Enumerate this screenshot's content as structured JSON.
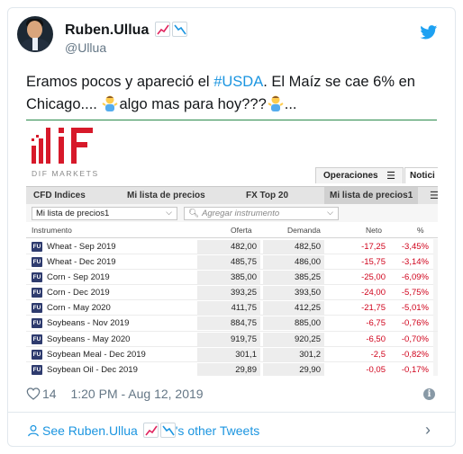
{
  "tweet": {
    "display_name": "Ruben.Ullua",
    "handle": "@Ullua",
    "text_part1": "Eramos pocos y apareció el ",
    "hashtag": "#USDA",
    "text_part2": ". El Maíz se cae 6% en Chicago.... ",
    "text_part3": "algo mas para hoy???",
    "text_part4": "...",
    "likes": "14",
    "timestamp": "1:20 PM - Aug 12, 2019",
    "footer_see": "See Ruben.Ullua",
    "footer_other": "'s other Tweets"
  },
  "platform": {
    "brand": "DIF MARKETS",
    "top_tabs": [
      "Operaciones",
      "Notici"
    ],
    "tabs": [
      "CFD Indices",
      "Mi lista de precios",
      "FX Top 20",
      "Mi lista de precios1"
    ],
    "active_tab_index": 3,
    "selected_list": "Mi lista de precios1",
    "search_placeholder": "Agregar instrumento",
    "columns": {
      "instrument": "Instrumento",
      "bid": "Oferta",
      "ask": "Demanda",
      "net": "Neto",
      "pct": "%"
    },
    "badge": "FU",
    "rows": [
      {
        "name": "Wheat - Sep 2019",
        "bid": "482,00",
        "ask": "482,50",
        "net": "-17,25",
        "pct": "-3,45%"
      },
      {
        "name": "Wheat - Dec 2019",
        "bid": "485,75",
        "ask": "486,00",
        "net": "-15,75",
        "pct": "-3,14%"
      },
      {
        "name": "Corn - Sep 2019",
        "bid": "385,00",
        "ask": "385,25",
        "net": "-25,00",
        "pct": "-6,09%"
      },
      {
        "name": "Corn - Dec 2019",
        "bid": "393,25",
        "ask": "393,50",
        "net": "-24,00",
        "pct": "-5,75%"
      },
      {
        "name": "Corn - May 2020",
        "bid": "411,75",
        "ask": "412,25",
        "net": "-21,75",
        "pct": "-5,01%"
      },
      {
        "name": "Soybeans - Nov 2019",
        "bid": "884,75",
        "ask": "885,00",
        "net": "-6,75",
        "pct": "-0,76%"
      },
      {
        "name": "Soybeans - May 2020",
        "bid": "919,75",
        "ask": "920,25",
        "net": "-6,50",
        "pct": "-0,70%"
      },
      {
        "name": "Soybean Meal - Dec 2019",
        "bid": "301,1",
        "ask": "301,2",
        "net": "-2,5",
        "pct": "-0,82%"
      },
      {
        "name": "Soybean Oil - Dec 2019",
        "bid": "29,89",
        "ask": "29,90",
        "net": "-0,05",
        "pct": "-0,17%"
      }
    ]
  },
  "colors": {
    "twitter_blue": "#1b95e0",
    "negative_red": "#d0021b",
    "brand_red": "#d7192a"
  },
  "icons": [
    "twitter-bird-icon",
    "heart-icon",
    "info-icon",
    "user-icon",
    "chevron-right-icon",
    "chart-up-emoji",
    "chart-down-emoji",
    "person-shrugging-emoji"
  ]
}
